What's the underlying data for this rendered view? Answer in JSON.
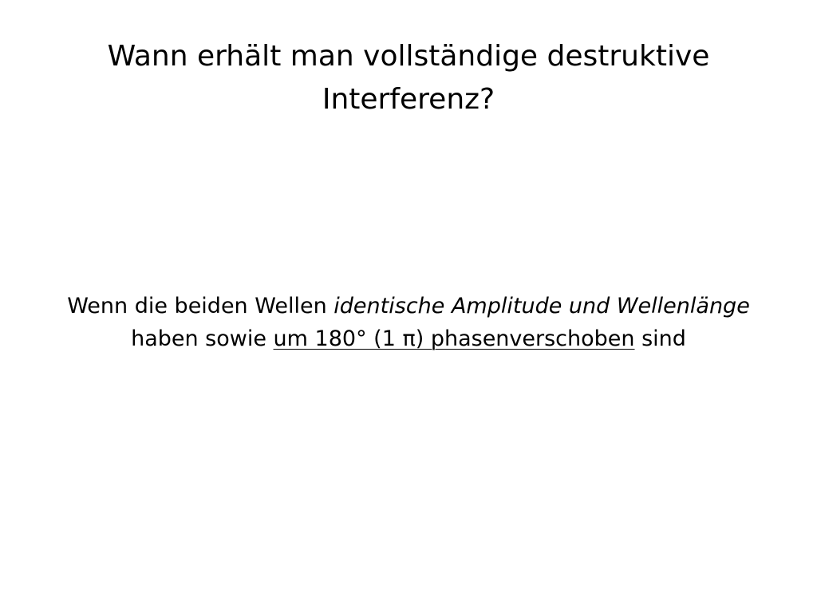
{
  "slide": {
    "title_line1": "Wann erhält man vollständige destruktive",
    "title_line2": "Interferenz?",
    "answer": {
      "line1_normal": "Wenn die beiden Wellen ",
      "line1_italic": "identische Amplitude und Wellenlänge",
      "line2_before": "haben sowie ",
      "line2_underlined": "um 180° (1 π) phasenverschoben",
      "line2_after": " sind"
    }
  }
}
